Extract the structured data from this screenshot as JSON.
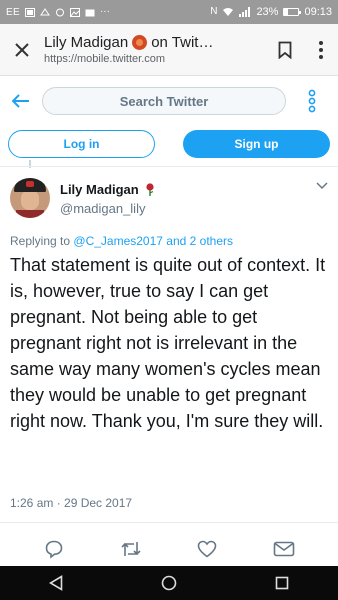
{
  "status_bar": {
    "carrier": "EE",
    "battery_text": "23%",
    "battery_level": 0.23,
    "time": "09:13",
    "more": "···",
    "nfc": "N"
  },
  "browser": {
    "page_title": "Lily Madigan",
    "page_title_suffix": "on Twit…",
    "url": "https://mobile.twitter.com"
  },
  "twitter_header": {
    "search_placeholder": "Search Twitter",
    "login_label": "Log in",
    "signup_label": "Sign up"
  },
  "tweet": {
    "display_name": "Lily Madigan",
    "handle": "@madigan_lily",
    "reply_prefix": "Replying to",
    "reply_targets": "@C_James2017 and 2 others",
    "text": "That statement is quite out of context. It is, however, true to say I can get pregnant. Not being able to get pregnant right not is irrelevant in the same way many women's cycles mean they would be unable to get pregnant right now. Thank you, I'm sure they will.",
    "timestamp": "1:26 am · 29 Dec 2017"
  },
  "colors": {
    "twitter_blue": "#1da1f2",
    "secondary_text": "#657786",
    "status_bar": "#9a9a9a",
    "rose": "#c0262d"
  },
  "icons": {
    "close": "close-icon",
    "bookmark": "bookmark-icon",
    "more": "more-vertical-icon",
    "back": "back-arrow-icon",
    "overflow": "overflow-dots-icon",
    "rose": "rose-icon",
    "caret": "chevron-down-icon",
    "reply": "reply-icon",
    "retweet": "retweet-icon",
    "like": "heart-icon",
    "message": "envelope-icon"
  }
}
